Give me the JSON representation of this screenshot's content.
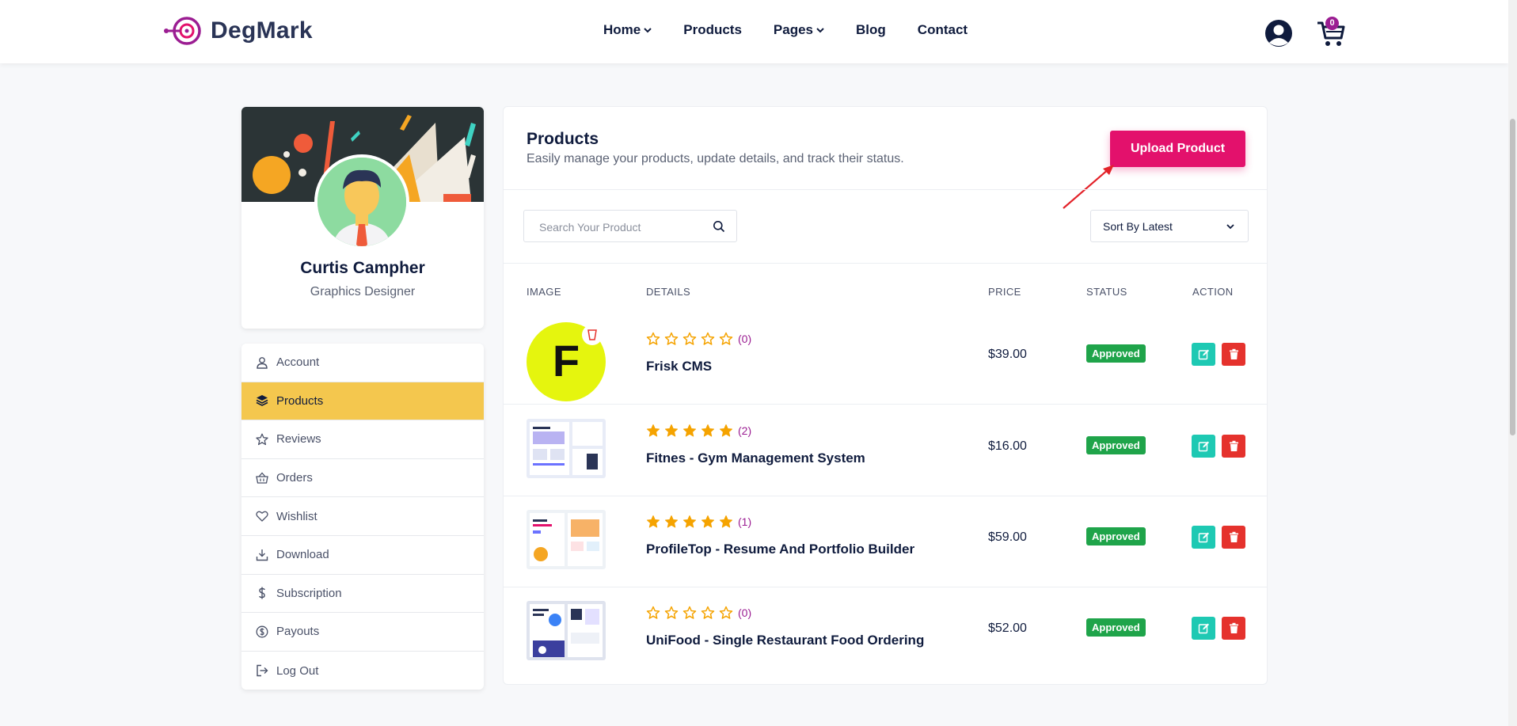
{
  "header": {
    "brand": "DegMark",
    "nav": [
      {
        "label": "Home",
        "dropdown": true
      },
      {
        "label": "Products",
        "dropdown": false
      },
      {
        "label": "Pages",
        "dropdown": true
      },
      {
        "label": "Blog",
        "dropdown": false
      },
      {
        "label": "Contact",
        "dropdown": false
      }
    ],
    "cart_count": "0",
    "colors": {
      "brand": "#9b1d92",
      "text": "#0f1b3d"
    }
  },
  "profile": {
    "name": "Curtis Campher",
    "role": "Graphics Designer"
  },
  "sidebar": {
    "items": [
      {
        "label": "Account",
        "icon": "user-icon",
        "active": false
      },
      {
        "label": "Products",
        "icon": "layers-icon",
        "active": true
      },
      {
        "label": "Reviews",
        "icon": "star-icon",
        "active": false
      },
      {
        "label": "Orders",
        "icon": "basket-icon",
        "active": false
      },
      {
        "label": "Wishlist",
        "icon": "heart-icon",
        "active": false
      },
      {
        "label": "Download",
        "icon": "download-icon",
        "active": false
      },
      {
        "label": "Subscription",
        "icon": "dollar-icon",
        "active": false
      },
      {
        "label": "Payouts",
        "icon": "coin-icon",
        "active": false
      },
      {
        "label": "Log Out",
        "icon": "logout-icon",
        "active": false
      }
    ],
    "active_color": "#f4c74e"
  },
  "panel": {
    "title": "Products",
    "subtitle": "Easily manage your products, update details, and track their status.",
    "upload_label": "Upload Product",
    "upload_color": "#e3116c",
    "search_placeholder": "Search Your Product",
    "sort_value": "Sort By Latest",
    "columns": [
      "IMAGE",
      "DETAILS",
      "PRICE",
      "STATUS",
      "ACTION"
    ]
  },
  "products": [
    {
      "name": "Frisk CMS",
      "rating": 0,
      "reviews": "(0)",
      "price": "$39.00",
      "status": "Approved",
      "thumb": "frisk-logo"
    },
    {
      "name": "Fitnes - Gym Management System",
      "rating": 5,
      "reviews": "(2)",
      "price": "$16.00",
      "status": "Approved",
      "thumb": "website-preview"
    },
    {
      "name": "ProfileTop - Resume And Portfolio Builder",
      "rating": 5,
      "reviews": "(1)",
      "price": "$59.00",
      "status": "Approved",
      "thumb": "website-preview"
    },
    {
      "name": "UniFood - Single Restaurant Food Ordering",
      "rating": 0,
      "reviews": "(0)",
      "price": "$52.00",
      "status": "Approved",
      "thumb": "website-preview"
    }
  ]
}
